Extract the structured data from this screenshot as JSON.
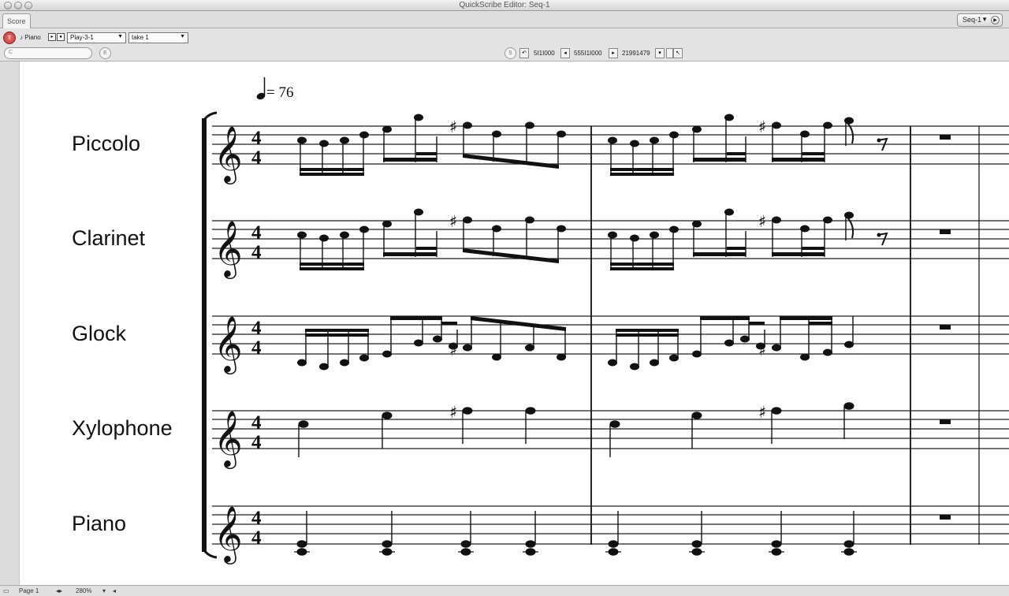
{
  "window": {
    "title": "QuickScribe Editor: Seq-1"
  },
  "tabs": [
    {
      "label": "Score"
    }
  ],
  "sequence_menu": {
    "value": "Seq-1"
  },
  "toolbar": {
    "record_label": "T",
    "instrument_label": "♪ Piano",
    "playlist_value": "Play-3-1",
    "take_value": "take 1",
    "search_label": "C",
    "e_label": "E"
  },
  "transport": {
    "s_label": "S",
    "position": "5I1I000",
    "end_position": "555I1I000",
    "length": "21991479"
  },
  "score": {
    "tempo_value": "= 76",
    "time_signature": {
      "top": "4",
      "bottom": "4"
    },
    "instruments": [
      {
        "name": "Piccolo"
      },
      {
        "name": "Clarinet"
      },
      {
        "name": "Glock"
      },
      {
        "name": "Xylophone"
      },
      {
        "name": "Piano"
      }
    ]
  },
  "status": {
    "page_label": "Page  1",
    "zoom_value": "280%"
  }
}
